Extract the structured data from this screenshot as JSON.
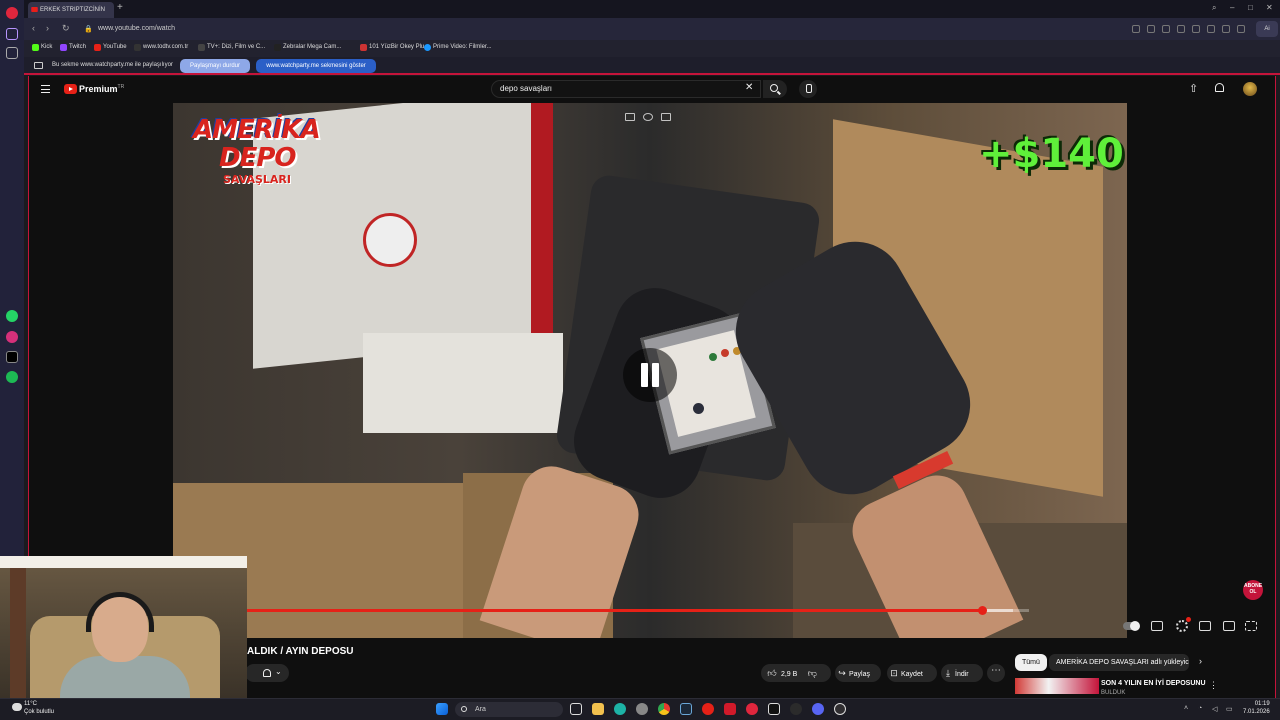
{
  "browser": {
    "tab_title": "ERKEK STRIPTIZCİNİN",
    "url": "www.youtube.com/watch",
    "ai_label": "Ai",
    "bookmarks": [
      "Kick",
      "Twitch",
      "YouTube",
      "www.todtv.com.tr",
      "TV+: Dizi, Film ve C...",
      "Zebralar Mega Cam...",
      "101 YüzBir Okey Plu...",
      "Prime Video: Filmler..."
    ]
  },
  "share_bar": {
    "text": "Bu sekme www.watchparty.me ile paylaşılıyor",
    "stop_button": "Paylaşmayı durdur",
    "show_button": "www.watchparty.me sekmesini göster"
  },
  "youtube": {
    "brand": "Premium",
    "brand_sup": "TR",
    "search_value": "depo savaşları",
    "video": {
      "overlay_logo_line1": "AMERİKA",
      "overlay_logo_line2": "DEPO",
      "overlay_logo_line3": "SAVAŞLARI",
      "price_overlay": "+$140",
      "progress_fraction": 0.94,
      "buffer_fraction": 0.98,
      "subscribe_badge": "ABONE OL"
    },
    "title": "ALDIK / AYIN DEPOSU",
    "actions": {
      "likes": "2,9 B",
      "share": "Paylaş",
      "save": "Kaydet",
      "download": "İndir"
    },
    "chips": {
      "all": "Tümü",
      "uploader": "AMERİKA DEPO SAVAŞLARI adlı yükleyiciden"
    },
    "related": {
      "title": "SON 4 YILIN EN İYİ DEPOSUNU",
      "subtitle": "BULDUK"
    }
  },
  "taskbar": {
    "weather_temp": "11°C",
    "weather_desc": "Çok bulutlu",
    "search_placeholder": "Ara",
    "time": "01:19",
    "date": "7.01.2026"
  },
  "colors": {
    "accent_red": "#e62117",
    "price_green": "#5ff03a",
    "share_blue": "#2b5fc7"
  }
}
